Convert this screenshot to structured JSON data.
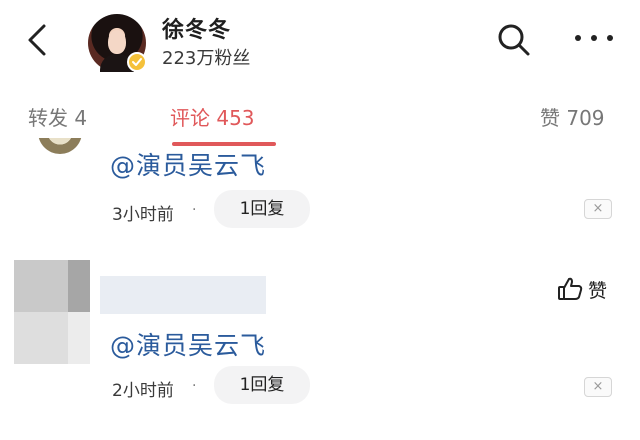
{
  "header": {
    "back_icon": "chevron-left-icon",
    "user_name": "徐冬冬",
    "follower_count": "223万粉丝",
    "verify_icon": "verified-badge-icon",
    "search_icon": "search-icon",
    "more_icon": "more-dots-icon"
  },
  "tabs": [
    {
      "label": "转发 4"
    },
    {
      "label": "评论 453"
    },
    {
      "label": "赞 709"
    }
  ],
  "active_tab": "评论 453",
  "comments": [
    {
      "text": "@演员吴云飞",
      "time": "3小时前",
      "separator": "·",
      "reply": "1回复",
      "close": "×"
    },
    {
      "text": "@演员吴云飞",
      "time": "2小时前",
      "separator": "·",
      "reply": "1回复",
      "close": "×",
      "like_label": "赞"
    }
  ],
  "colors": {
    "accent": "#e0585a",
    "mention": "#2b5b9c",
    "verify_badge": "#f5c13a"
  }
}
